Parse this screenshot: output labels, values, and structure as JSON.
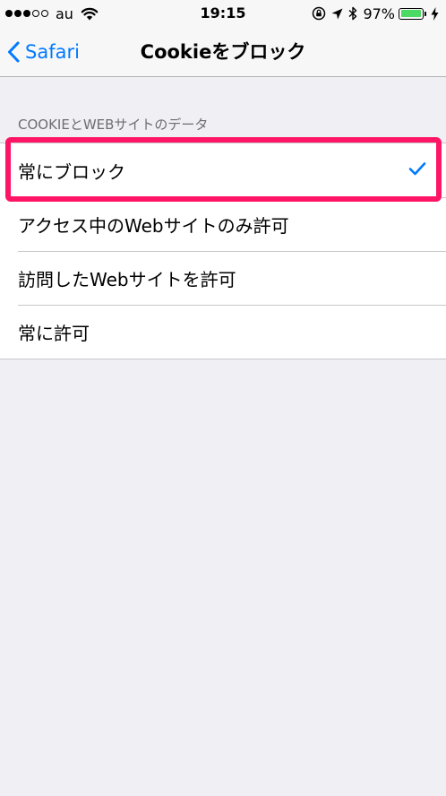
{
  "status_bar": {
    "carrier": "au",
    "time": "19:15",
    "battery_percent": "97%",
    "battery_level": 0.97,
    "icons": [
      "signal-dots",
      "wifi-icon",
      "orientation-lock-icon",
      "location-arrow-icon",
      "bluetooth-icon",
      "battery-icon",
      "charging-bolt-icon"
    ]
  },
  "nav": {
    "back_label": "Safari",
    "title": "Cookieをブロック"
  },
  "section": {
    "header": "COOKIEとWEBサイトのデータ",
    "options": [
      {
        "label": "常にブロック",
        "selected": true
      },
      {
        "label": "アクセス中のWebサイトのみ許可",
        "selected": false
      },
      {
        "label": "訪問したWebサイトを許可",
        "selected": false
      },
      {
        "label": "常に許可",
        "selected": false
      }
    ]
  },
  "colors": {
    "accent": "#007aff",
    "highlight": "#ff1566",
    "background": "#efeff4",
    "battery": "#4cd964"
  }
}
